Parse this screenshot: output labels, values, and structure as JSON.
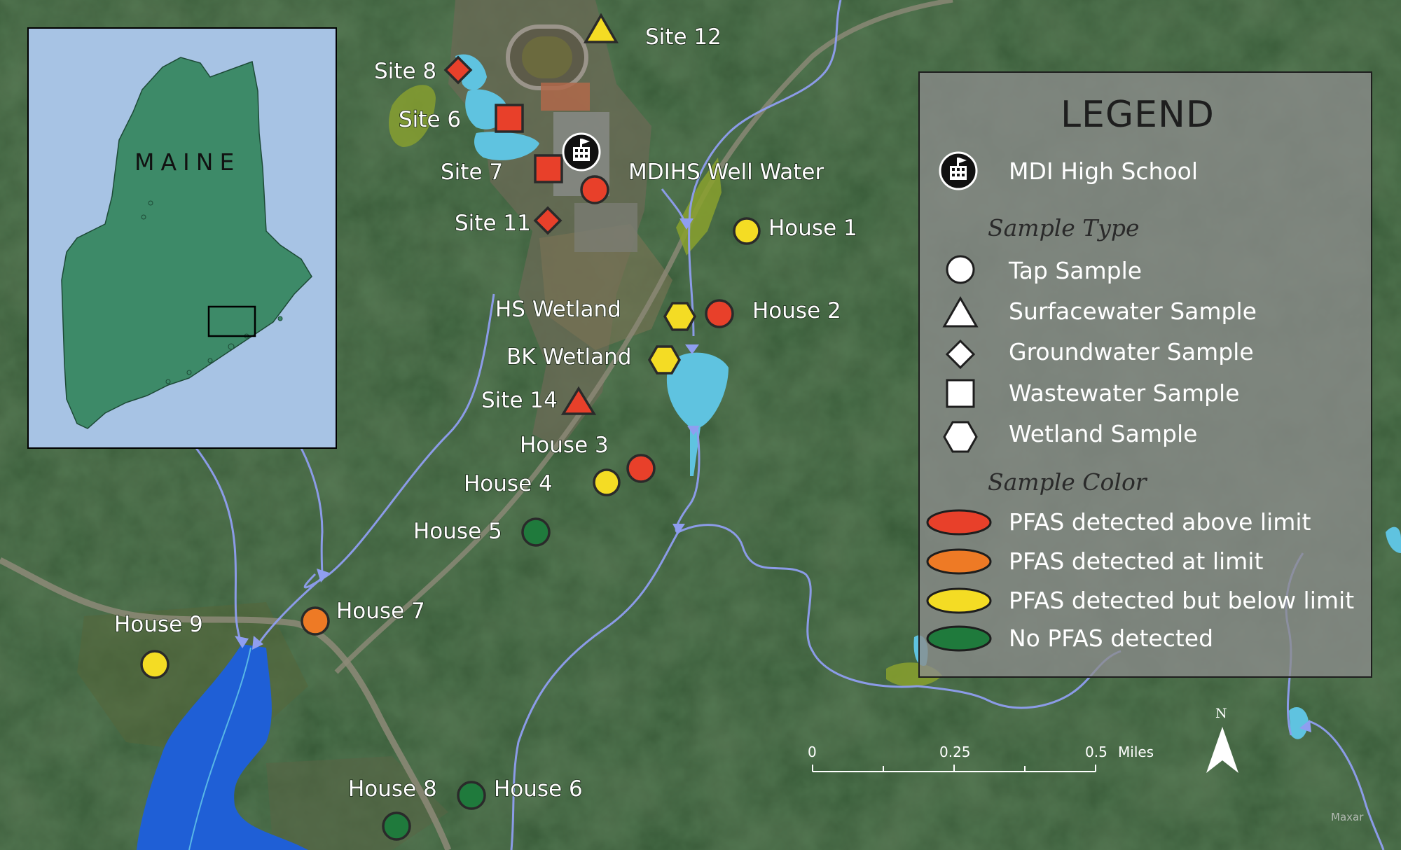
{
  "map": {
    "legend": {
      "title": "LEGEND",
      "school_label": "MDI High School",
      "sample_type_heading": "Sample Type",
      "types": [
        {
          "shape": "circle",
          "label": "Tap Sample"
        },
        {
          "shape": "triangle",
          "label": "Surfacewater Sample"
        },
        {
          "shape": "diamond",
          "label": "Groundwater Sample"
        },
        {
          "shape": "square",
          "label": "Wastewater Sample"
        },
        {
          "shape": "hexagon",
          "label": "Wetland Sample"
        }
      ],
      "sample_color_heading": "Sample Color",
      "colors": [
        {
          "color": "#e8402a",
          "label": "PFAS detected above limit"
        },
        {
          "color": "#ee7a25",
          "label": "PFAS detected at limit"
        },
        {
          "color": "#f4dc24",
          "label": "PFAS detected but below limit"
        },
        {
          "color": "#1f7a3c",
          "label": "No PFAS detected"
        }
      ]
    },
    "inset": {
      "label": "MAINE"
    },
    "scale": {
      "t0": "0",
      "t1": "0.25",
      "t2": "0.5",
      "unit": "Miles"
    },
    "north": "N",
    "credit": "Maxar",
    "sites": [
      {
        "name": "Site 12",
        "type": "triangle",
        "color": "#f4dc24"
      },
      {
        "name": "Site 8",
        "type": "diamond",
        "color": "#e8402a"
      },
      {
        "name": "Site 6",
        "type": "square",
        "color": "#e8402a"
      },
      {
        "name": "Site 7",
        "type": "square",
        "color": "#e8402a"
      },
      {
        "name": "MDIHS Well Water",
        "type": "circle",
        "color": "#e8402a"
      },
      {
        "name": "Site 11",
        "type": "diamond",
        "color": "#e8402a"
      },
      {
        "name": "House 1",
        "type": "circle",
        "color": "#f4dc24"
      },
      {
        "name": "HS Wetland",
        "type": "hexagon",
        "color": "#f4dc24"
      },
      {
        "name": "House 2",
        "type": "circle",
        "color": "#e8402a"
      },
      {
        "name": "BK Wetland",
        "type": "hexagon",
        "color": "#f4dc24"
      },
      {
        "name": "Site 14",
        "type": "triangle",
        "color": "#e8402a"
      },
      {
        "name": "House 3",
        "type": "circle",
        "color": "#e8402a"
      },
      {
        "name": "House 4",
        "type": "circle",
        "color": "#f4dc24"
      },
      {
        "name": "House 5",
        "type": "circle",
        "color": "#1f7a3c"
      },
      {
        "name": "House 7",
        "type": "circle",
        "color": "#ee7a25"
      },
      {
        "name": "House 9",
        "type": "circle",
        "color": "#f4dc24"
      },
      {
        "name": "House 8",
        "type": "circle",
        "color": "#1f7a3c"
      },
      {
        "name": "House 6",
        "type": "circle",
        "color": "#1f7a3c"
      }
    ]
  }
}
